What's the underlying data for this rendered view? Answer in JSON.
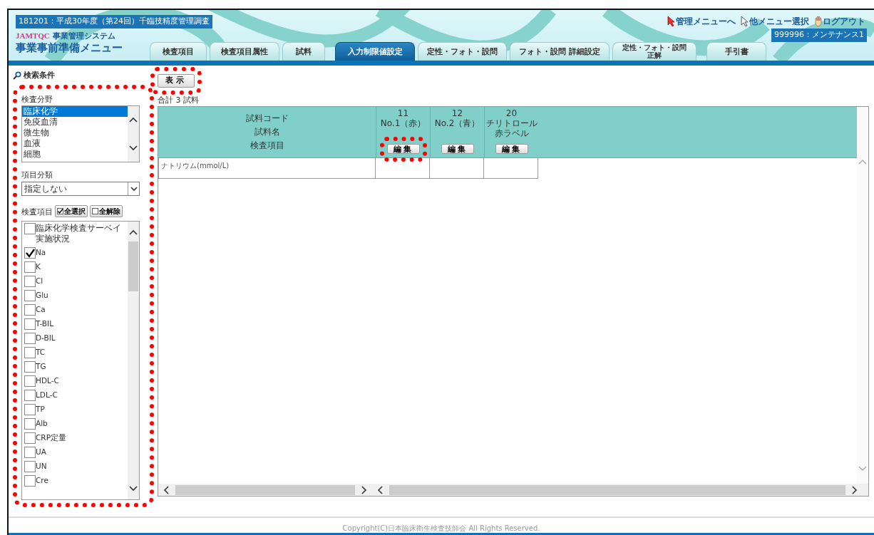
{
  "header": {
    "notice": "181201：平成30年度（第24回）千臨技精度管理調査",
    "brand": "JAMTQC",
    "system_name": "事業管理システム",
    "menu_title": "事業事前準備メニュー",
    "links": [
      {
        "kind": "admin",
        "label": "管理メニューへ"
      },
      {
        "kind": "other",
        "label": "他メニュー選択"
      },
      {
        "kind": "logout",
        "label": "ログアウト"
      }
    ],
    "user": "999996：メンテナンス1",
    "tabs": [
      {
        "lines": [
          "検査項目"
        ],
        "selected": false
      },
      {
        "lines": [
          "検査項目属性"
        ],
        "selected": false
      },
      {
        "lines": [
          "試料"
        ],
        "selected": false
      },
      {
        "lines": [
          "入力制限値設定"
        ],
        "selected": true
      },
      {
        "lines": [
          "定性・フォト・設問"
        ],
        "selected": false
      },
      {
        "lines": [
          "フォト・設問 詳細設定"
        ],
        "selected": false
      },
      {
        "lines": [
          "定性・フォト・設問",
          "正解"
        ],
        "selected": false
      },
      {
        "lines": [
          "手引書"
        ],
        "selected": false
      }
    ]
  },
  "search": {
    "title": "検索条件",
    "field_label": "検査分野",
    "fields": [
      {
        "label": "臨床化学",
        "selected": true
      },
      {
        "label": "免疫血清",
        "selected": false
      },
      {
        "label": "微生物",
        "selected": false
      },
      {
        "label": "血液",
        "selected": false
      },
      {
        "label": "細胞",
        "selected": false
      }
    ],
    "category_label": "項目分類",
    "category_value": "指定しない",
    "items_label": "検査項目",
    "select_all": "全選択",
    "clear_all": "全解除",
    "items": [
      {
        "label": "臨床化学検査サーベイ実施状況",
        "checked": false
      },
      {
        "label": "Na",
        "checked": true
      },
      {
        "label": "K",
        "checked": false
      },
      {
        "label": "Cl",
        "checked": false
      },
      {
        "label": "Glu",
        "checked": false
      },
      {
        "label": "Ca",
        "checked": false
      },
      {
        "label": "T-BIL",
        "checked": false
      },
      {
        "label": "D-BIL",
        "checked": false
      },
      {
        "label": "TC",
        "checked": false
      },
      {
        "label": "TG",
        "checked": false
      },
      {
        "label": "HDL-C",
        "checked": false
      },
      {
        "label": "LDL-C",
        "checked": false
      },
      {
        "label": "TP",
        "checked": false
      },
      {
        "label": "Alb",
        "checked": false
      },
      {
        "label": "CRP定量",
        "checked": false
      },
      {
        "label": "UA",
        "checked": false
      },
      {
        "label": "UN",
        "checked": false
      },
      {
        "label": "Cre",
        "checked": false
      }
    ]
  },
  "display_button": "表示",
  "total": "合計 3 試料",
  "table": {
    "header_labels": [
      "試料コード",
      "試料名",
      "検査項目"
    ],
    "samples": [
      {
        "code": "11",
        "name": [
          "No.1（赤）"
        ],
        "button": "編集"
      },
      {
        "code": "12",
        "name": [
          "No.2（青）"
        ],
        "button": "編集"
      },
      {
        "code": "20",
        "name": [
          "チリトロール",
          "赤ラベル"
        ],
        "button": "編集"
      }
    ],
    "rows": [
      {
        "label": "ナトリウム(mmol/L)"
      }
    ]
  },
  "footer": "Copyright(C)日本臨床衛生検査技師会 All Rights Reserved."
}
